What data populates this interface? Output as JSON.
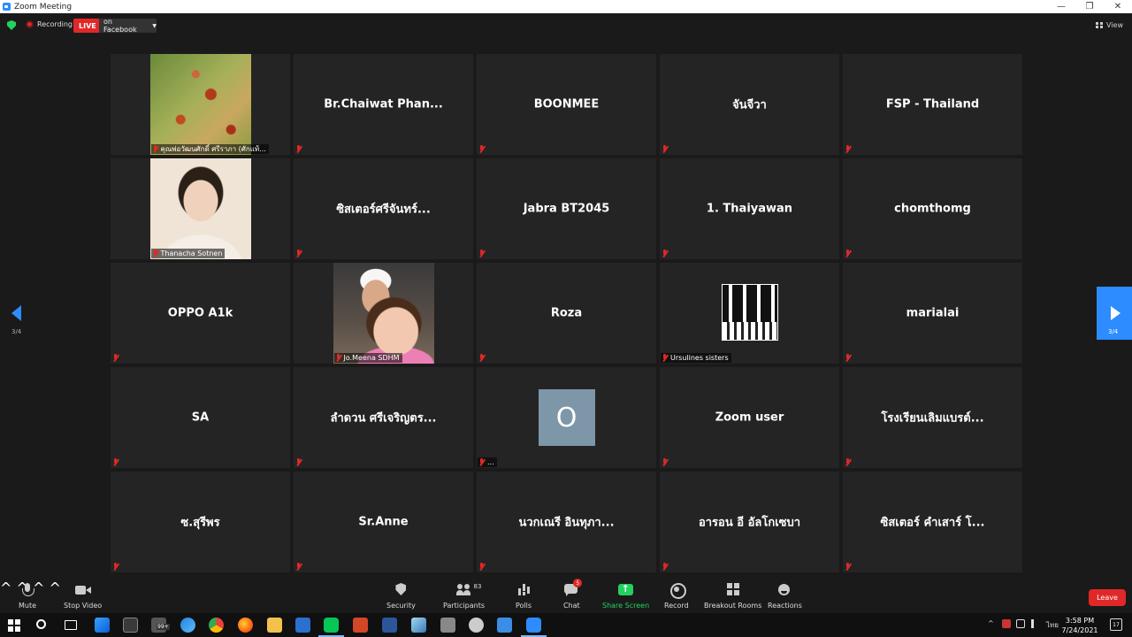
{
  "window": {
    "title": "Zoom Meeting",
    "controls": {
      "minimize": "—",
      "restore": "❐",
      "close": "✕"
    }
  },
  "topbar": {
    "recording_label": "Recording",
    "live_label": "LIVE",
    "live_target": "on Facebook",
    "view_label": "View"
  },
  "pagination": {
    "prev_page": "3/4",
    "next_page": "3/4"
  },
  "participants": [
    {
      "name": "",
      "caption": "คุณพ่อวัฒนศักดิ์  ศรีราภา  (ศักแท้...",
      "video": "flower"
    },
    {
      "name": "Br.Chaiwat  Phan...",
      "caption": ""
    },
    {
      "name": "BOONMEE",
      "caption": ""
    },
    {
      "name": "จันจีวา",
      "caption": ""
    },
    {
      "name": "FSP - Thailand",
      "caption": ""
    },
    {
      "name": "",
      "caption": "Thanacha Sotnen",
      "video": "person"
    },
    {
      "name": "ซิสเตอร์ศรีจันทร์...",
      "caption": ""
    },
    {
      "name": "Jabra BT2045",
      "caption": ""
    },
    {
      "name": "1. Thaiyawan",
      "caption": ""
    },
    {
      "name": "chomthomg",
      "caption": ""
    },
    {
      "name": "OPPO A1k",
      "caption": ""
    },
    {
      "name": "",
      "caption": "Jo.Meena SDHM",
      "video": "child"
    },
    {
      "name": "Roza",
      "caption": ""
    },
    {
      "name": "",
      "caption": "Ursulines sisters",
      "video": "nuns"
    },
    {
      "name": "marialai",
      "caption": ""
    },
    {
      "name": "SA",
      "caption": ""
    },
    {
      "name": "ลำดวน  ศรีเจริญตร...",
      "caption": ""
    },
    {
      "name": "",
      "caption": "...",
      "avatar": "O"
    },
    {
      "name": "Zoom user",
      "caption": ""
    },
    {
      "name": "โรงเรียนเลิมแบรต์...",
      "caption": ""
    },
    {
      "name": "ซ.สุรีพร",
      "caption": ""
    },
    {
      "name": "Sr.Anne",
      "caption": ""
    },
    {
      "name": "นวกเณรี  อินทุภา...",
      "caption": ""
    },
    {
      "name": "อารอน  อี  อัลโกเซบา",
      "caption": ""
    },
    {
      "name": "ซิสเตอร์  คำเสาร์  โ...",
      "caption": ""
    }
  ],
  "toolbar": {
    "mute": "Mute",
    "stop_video": "Stop Video",
    "security": "Security",
    "participants": "Participants",
    "participants_count": "83",
    "polls": "Polls",
    "chat": "Chat",
    "chat_badge": "5",
    "share_screen": "Share Screen",
    "record": "Record",
    "breakout_rooms": "Breakout Rooms",
    "reactions": "Reactions",
    "leave": "Leave",
    "caret": "^"
  },
  "taskbar": {
    "overflow_badge": "99+",
    "language": "ไทย",
    "time": "3:58 PM",
    "date": "7/24/2021",
    "notification_count": "17",
    "tray_chevron": "^"
  },
  "colors": {
    "accent": "#2d8cff",
    "danger": "#e02828",
    "share": "#23d160",
    "tile": "#242424",
    "background": "#1a1a1a"
  }
}
